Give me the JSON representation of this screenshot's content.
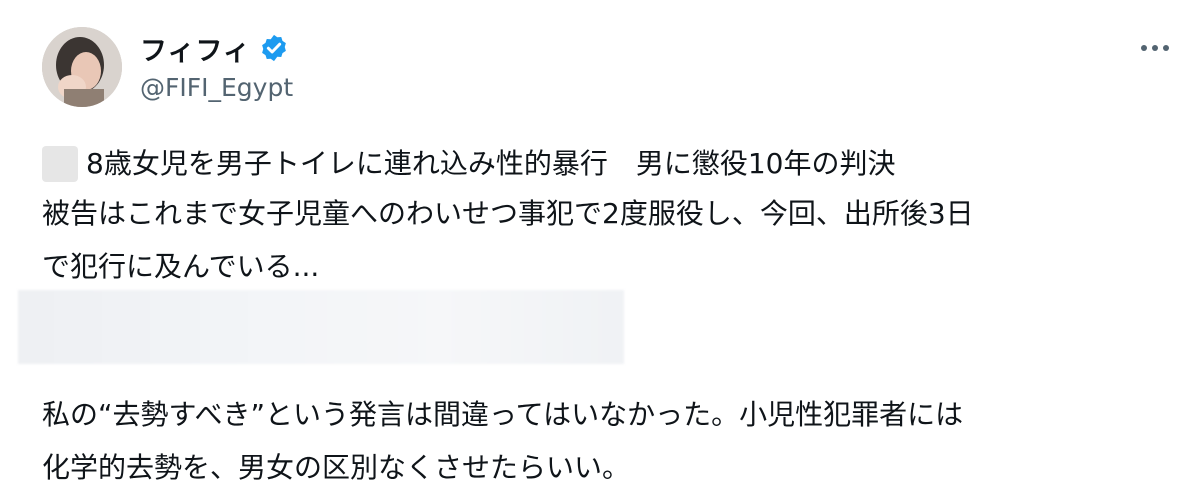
{
  "author": {
    "display_name": "フィフィ",
    "handle": "@FIFI_Egypt"
  },
  "post": {
    "line1": "8歳女児を男子トイレに連れ込み性的暴行　男に懲役10年の判決",
    "line2": "被告はこれまで女子児童へのわいせつ事犯で2度服役し、今回、出所後3日",
    "line3": "で犯行に及んでいる...",
    "line4": "私の“去勢すべき”という発言は間違ってはいなかった。小児性犯罪者には",
    "line5": "化学的去勢を、男女の区別なくさせたらいい。"
  },
  "icons": {
    "verified": "verified-badge-icon",
    "more": "more-options-icon",
    "avatar": "user-avatar"
  },
  "colors": {
    "verified": "#1d9bf0",
    "handle": "#536471",
    "text": "#0f1419"
  }
}
